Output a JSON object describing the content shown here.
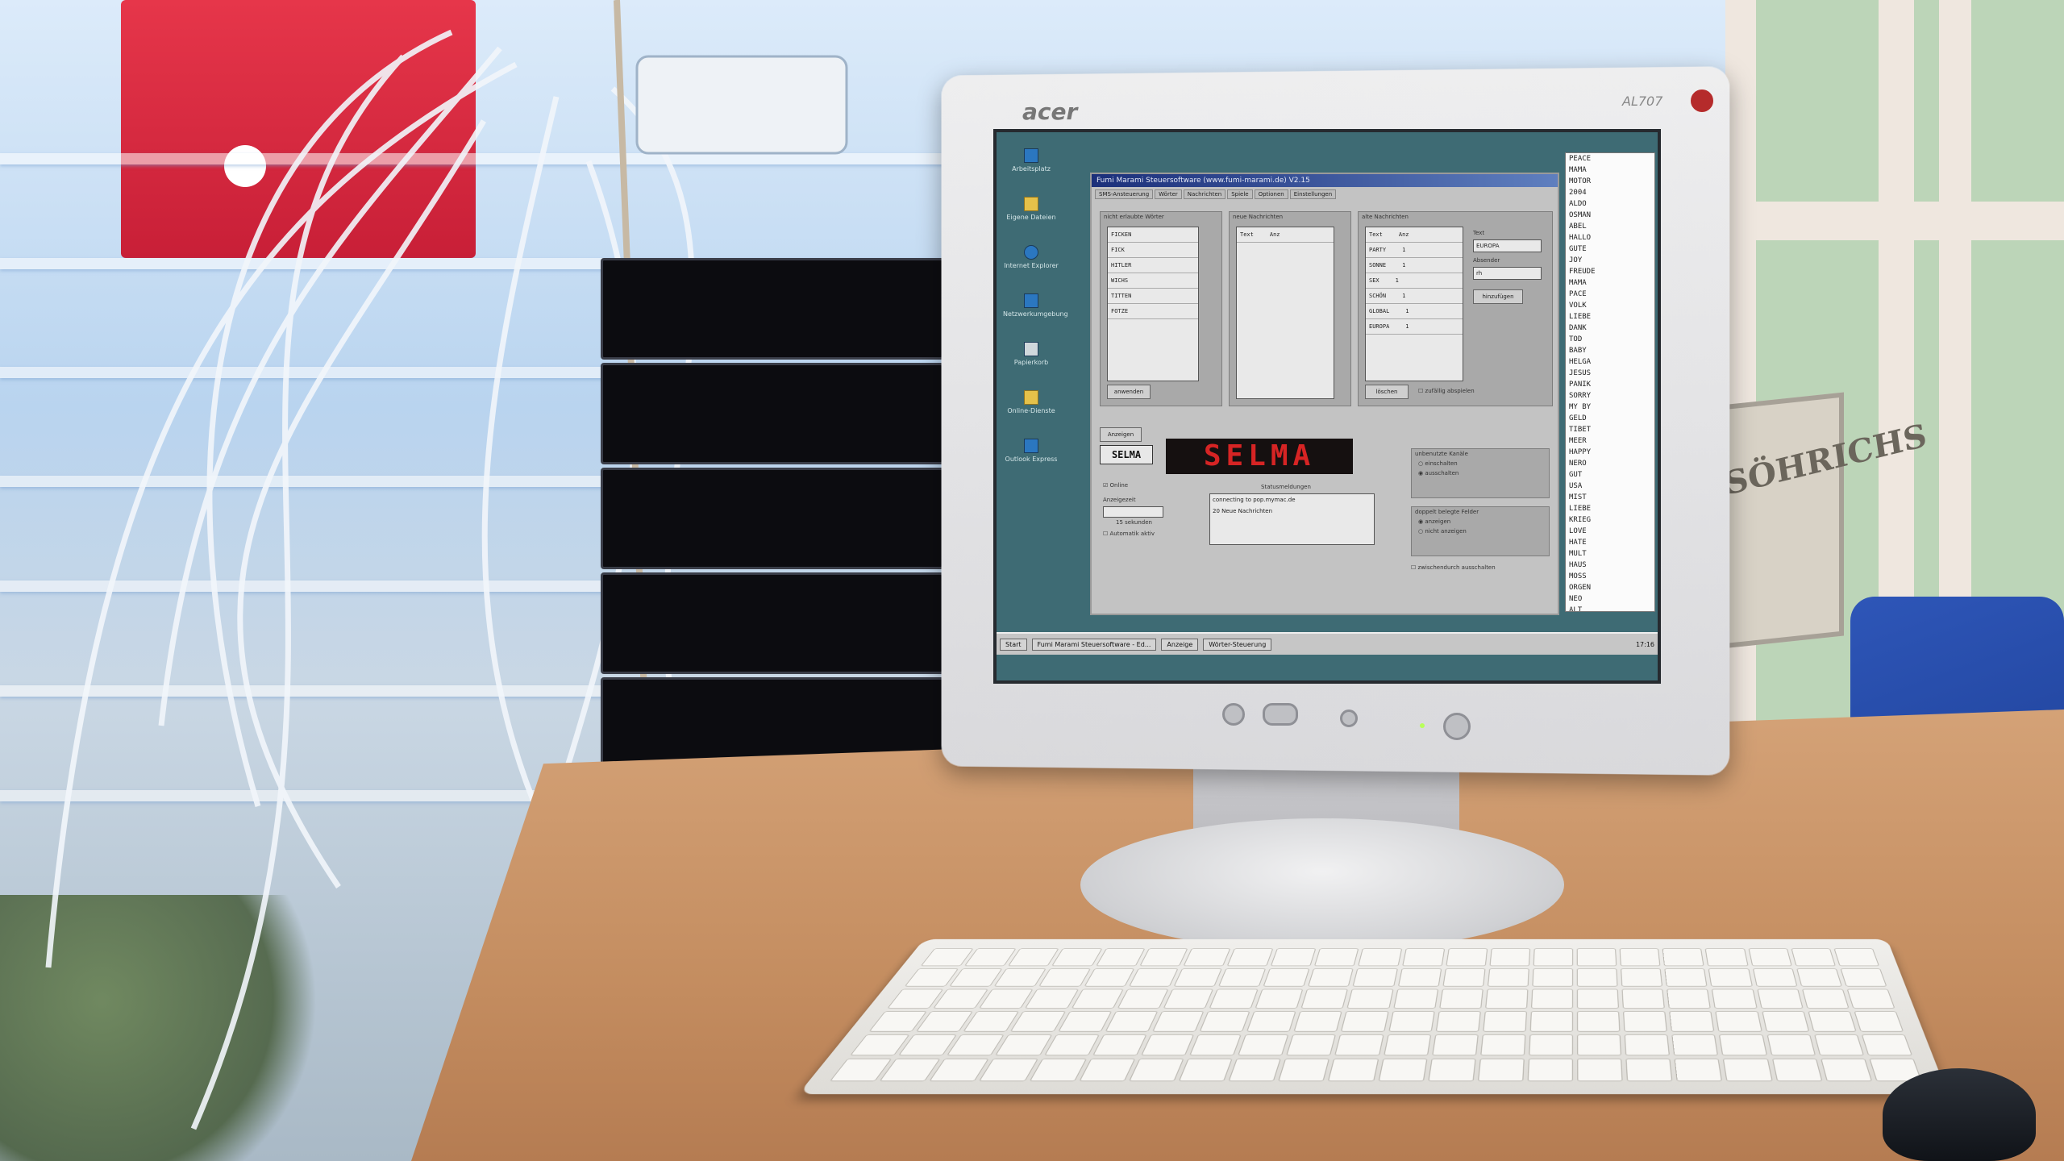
{
  "monitor": {
    "brand": "acer",
    "model": "AL707"
  },
  "desktop_icons": [
    {
      "label": "Arbeitsplatz",
      "icon": "computer-icon"
    },
    {
      "label": "Eigene Dateien",
      "icon": "folder-icon"
    },
    {
      "label": "Internet Explorer",
      "icon": "globe-icon"
    },
    {
      "label": "Netzwerkumgebung",
      "icon": "network-icon"
    },
    {
      "label": "Papierkorb",
      "icon": "trash-icon"
    },
    {
      "label": "Online-Dienste",
      "icon": "folder-icon"
    },
    {
      "label": "Outlook Express",
      "icon": "mail-icon"
    }
  ],
  "app": {
    "title": "Fumi Marami Steuersoftware (www.fumi-marami.de) V2.15",
    "tabs": [
      "SMS-Ansteuerung",
      "Wörter",
      "Nachrichten",
      "Spiele",
      "Optionen",
      "Einstellungen"
    ],
    "groups": {
      "left_label": "nicht erlaubte Wörter",
      "middle_label": "neue Nachrichten",
      "right_label": "alte Nachrichten"
    },
    "left_list": [
      "FICKEN",
      "FICK",
      "HITLER",
      "WICHS",
      "TITTEN",
      "FOTZE"
    ],
    "middle_header": [
      "Text",
      "Anz"
    ],
    "right_header": [
      "Text",
      "Anz"
    ],
    "right_list": [
      {
        "text": "PARTY",
        "count": "1"
      },
      {
        "text": "SONNE",
        "count": "1"
      },
      {
        "text": "SEX",
        "count": "1"
      },
      {
        "text": "SCHÖN",
        "count": "1"
      },
      {
        "text": "GLOBAL",
        "count": "1"
      },
      {
        "text": "EUROPA",
        "count": "1"
      }
    ],
    "text_field_label": "Text",
    "text_field_value": "EUROPA",
    "sender_label": "Absender",
    "sender_value": "rh",
    "add_button": "hinzufügen",
    "apply_button": "anwenden",
    "delete_button": "löschen",
    "random_checkbox": "zufällig abspielen",
    "display_button": "Anzeigen",
    "display_word": "SELMA",
    "led_text": "SELMA",
    "online_label": "Online",
    "display_time_label": "Anzeigezeit",
    "seconds_label": "15 sekunden",
    "auto_label": "Automatik aktiv",
    "status_label": "Statusmeldungen",
    "status_lines": [
      "connecting to pop.mymac.de",
      "20 Neue Nachrichten"
    ],
    "unused_channels_label": "unbenutzte Kanäle",
    "unused_options": [
      "einschalten",
      "ausschalten"
    ],
    "double_fields_label": "doppelt belegte Felder",
    "double_options": [
      "anzeigen",
      "nicht anzeigen"
    ],
    "alternate_option": "zwischendurch ausschalten"
  },
  "wordlist": [
    "PEACE",
    "MAMA",
    "MOTOR",
    "2004",
    "ALDO",
    "OSMAN",
    "ABEL",
    "HALLO",
    "GUTE",
    "JOY",
    "FREUDE",
    "MAMA",
    "PACE",
    "VOLK",
    "LIEBE",
    "DANK",
    "TOD",
    "BABY",
    "HELGA",
    "JESUS",
    "PANIK",
    "SORRY",
    "MY BY",
    "GELD",
    "TIBET",
    "MEER",
    "HAPPY",
    "NERO",
    "GUT",
    "USA",
    "MIST",
    "LIEBE",
    "KRIEG",
    "LOVE",
    "HATE",
    "MULT",
    "HAUS",
    "MOSS",
    "ORGEN",
    "NEO",
    "ALT"
  ],
  "taskbar": {
    "start": "Start",
    "tasks": [
      "Fumi Marami Steuersoftware - Ed...",
      "Anzeige",
      "Wörter-Steuerung"
    ],
    "clock": "17:16"
  }
}
